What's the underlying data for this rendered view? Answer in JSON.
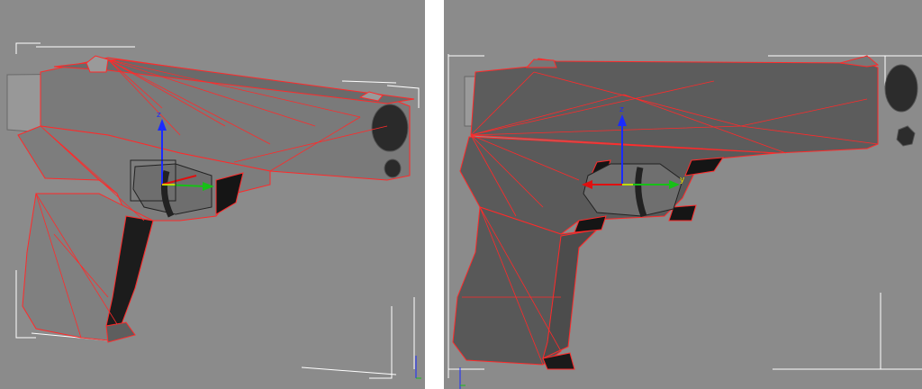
{
  "viewports": {
    "left": {
      "background": "#8b8b8b",
      "gizmo_axis_labels": {
        "z": "z"
      }
    },
    "right": {
      "background": "#8b8b8b",
      "gizmo_axis_labels": {
        "z": "z",
        "y": "y"
      }
    }
  },
  "colors": {
    "mesh_face": "#787878",
    "mesh_face_dark": "#5a5a5a",
    "wire": "#ff2a2a",
    "bracket": "#ffffff",
    "axis_x": "#e01010",
    "axis_y": "#17c017",
    "axis_z": "#1a2bff",
    "axis_highlight": "#f2e600"
  },
  "icons": [
    "transform-gizmo-icon",
    "world-axis-tripod-icon"
  ]
}
